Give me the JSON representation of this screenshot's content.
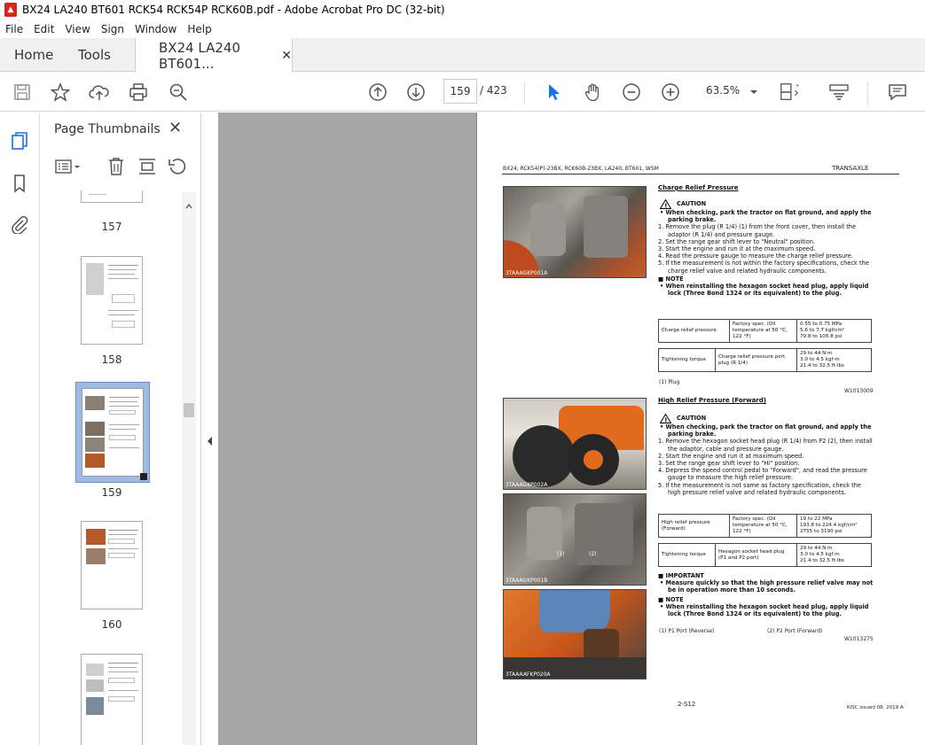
{
  "window": {
    "title": "BX24 LA240 BT601 RCK54 RCK54P RCK60B.pdf - Adobe Acrobat Pro DC (32-bit)"
  },
  "menu": [
    "File",
    "Edit",
    "View",
    "Sign",
    "Window",
    "Help"
  ],
  "tabs": {
    "home": "Home",
    "tools": "Tools",
    "document": "BX24 LA240 BT601..."
  },
  "toolbar": {
    "page_current": "159",
    "page_total": "/ 423",
    "zoom": "63.5%"
  },
  "thumbnails": {
    "title": "Page Thumbnails",
    "pages": [
      {
        "label": "157"
      },
      {
        "label": "158"
      },
      {
        "label": "159"
      },
      {
        "label": "160"
      }
    ]
  },
  "doc": {
    "header_left": "BX24, RCK54(P)-23BX, RCK60B-23BX, LA240, BT601, WSM",
    "header_right": "TRANSAXLE",
    "sec1": {
      "title": "Charge Relief Pressure",
      "caution": "CAUTION",
      "bullet": "When checking, park the tractor on flat ground, and apply the parking brake.",
      "steps": [
        "1. Remove the plug (R 1/4) (1) from the front cover, then install the adaptor (R 1/4) and pressure gauge.",
        "2. Set the range gear shift lever to \"Neutral\" position.",
        "3. Start the engine and run it at the maximum speed.",
        "4. Read the pressure gauge to measure the charge relief pressure.",
        "5. If the measurement is not within the factory specifications, check the charge relief valve and related hydraulic components."
      ],
      "note": "NOTE",
      "note_text": "When reinstalling the hexagon socket head plug, apply liquid lock (Three Bond 1324 or its equivalent) to the plug.",
      "table1": {
        "c1": "Charge relief pressure",
        "c2": "Factory spec. (Oil temperature at 50 °C, 122 °F)",
        "c3a": "0.55 to 0.75 MPa",
        "c3b": "5.6 to 7.7 kgf/cm²",
        "c3c": "79.8 to 108.8 psi"
      },
      "table2": {
        "c1": "Tightening torque",
        "c2": "Charge relief pressure port plug (R 1/4)",
        "c3a": "29 to 44 N·m",
        "c3b": "3.0 to 4.5 kgf·m",
        "c3c": "21.4 to 32.5 ft-lbs"
      },
      "ref": "(1) Plug",
      "code": "W1013009",
      "photo_caption": "3TAAAGKP001A"
    },
    "sec2": {
      "title": "High Relief Pressure (Forward)",
      "caution": "CAUTION",
      "bullet": "When checking, park the tractor on flat ground, and apply the parking brake.",
      "steps": [
        "1. Remove the hexagon socket head plug (R 1/4) from P2 (2), then install the adaptor, cable and pressure gauge.",
        "2. Start the engine and run it at maximum speed.",
        "3. Set the range gear shift lever to \"Hi\" position.",
        "4. Depress the speed control pedal to \"Forward\", and read the pressure gauge to measure the high relief pressure.",
        "5. If the measurement is not same as factory specification, check the high pressure relief valve and related hydraulic components."
      ],
      "table1": {
        "c1": "High relief pressure (Forward)",
        "c2": "Factory spec. (Oil temperature at 50 °C, 122 °F)",
        "c3a": "19 to 22 MPa",
        "c3b": "193.8 to 224.4 kgf/cm²",
        "c3c": "2755 to 3190 psi"
      },
      "table2": {
        "c1": "Tightening torque",
        "c2": "Hexagon socket head plug (P1 and P2 port)",
        "c3a": "29 to 44 N·m",
        "c3b": "3.0 to 4.5 kgf·m",
        "c3c": "21.4 to 32.5 ft-lbs"
      },
      "important": "IMPORTANT",
      "important_text": "Measure quickly so that the high pressure relief valve may not be in operation more than 10 seconds.",
      "note": "NOTE",
      "note_text": "When reinstalling the hexagon socket head plug, apply liquid lock (Three Bond 1324 or its equivalent) to the plug.",
      "ref1": "(1) P1 Port (Reverse)",
      "ref2": "(2) P2 Port (Forward)",
      "code": "W1013275",
      "photo1_caption": "3TAAAGKP002A",
      "photo2_caption": "3TAAAGKP001B",
      "photo3_caption": "3TAAAAFKP020A"
    },
    "page_number": "2-S12",
    "footer_right": "KiSC issued 08, 2019 A"
  },
  "icons": {
    "pdf": "pdf-icon",
    "save": "save-icon",
    "star": "star-icon",
    "upload": "upload-icon",
    "print": "print-icon",
    "zoom": "zoom-icon"
  }
}
